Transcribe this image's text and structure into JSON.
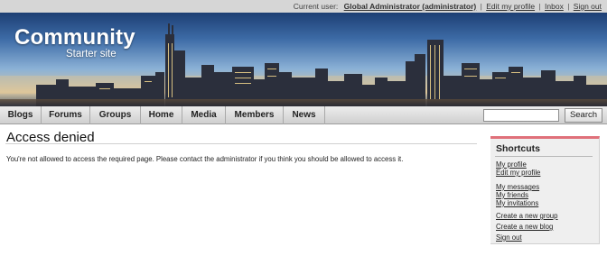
{
  "userbar": {
    "label": "Current user:",
    "user": "Global Administrator (administrator)",
    "edit_profile": "Edit my profile",
    "inbox": "Inbox",
    "sign_out": "Sign out",
    "sep": "|"
  },
  "banner": {
    "title": "Community",
    "subtitle": "Starter site"
  },
  "nav": {
    "items": [
      "Blogs",
      "Forums",
      "Groups",
      "Home",
      "Media",
      "Members",
      "News"
    ],
    "search_placeholder": "",
    "search_button": "Search"
  },
  "main": {
    "title": "Access denied",
    "message": "You're not allowed to access the required page. Please contact the administrator if you think you should be allowed to access it."
  },
  "shortcuts": {
    "title": "Shortcuts",
    "links": [
      "My profile",
      "Edit my profile",
      "My messages",
      "My friends",
      "My invitations",
      "Create a new group",
      "Create a new blog",
      "Sign out"
    ]
  },
  "colors": {
    "accent_border": "#e0707a",
    "nav_background": "#d6d6d6"
  }
}
